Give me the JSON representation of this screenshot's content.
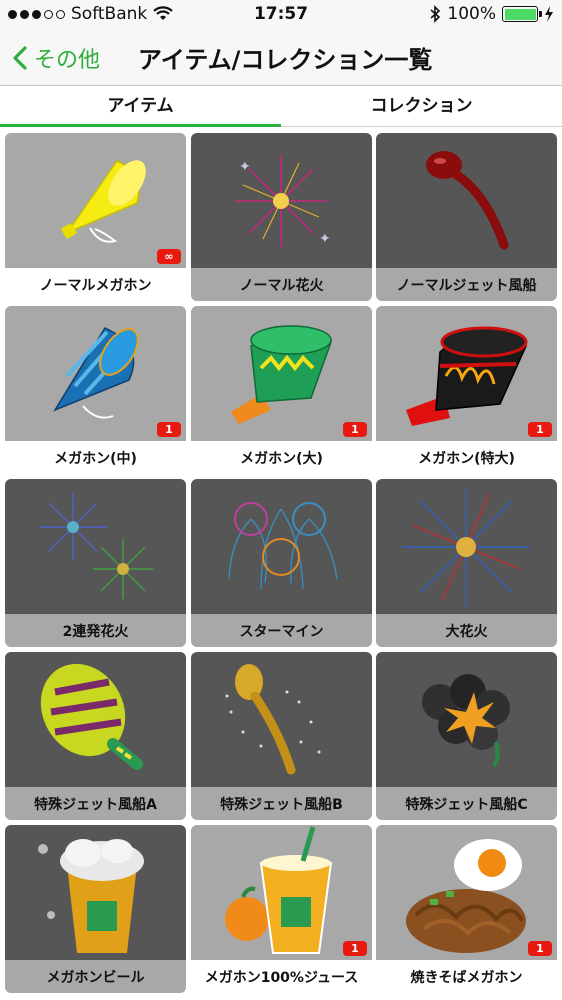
{
  "status_bar": {
    "carrier": "SoftBank",
    "time": "17:57",
    "battery_percent": "100%",
    "signal_bars_filled": 3,
    "signal_bars_total": 5
  },
  "nav": {
    "back_label": "その他",
    "title": "アイテム/コレクション一覧"
  },
  "tabs": [
    {
      "label": "アイテム",
      "active": true
    },
    {
      "label": "コレクション",
      "active": false
    }
  ],
  "colors": {
    "accent": "#2eae3a",
    "badge": "#e8190f"
  },
  "items": [
    {
      "name": "ノーマルメガホン",
      "badge": "∞",
      "owned": true,
      "icon": "megaphone-yellow-icon"
    },
    {
      "name": "ノーマル花火",
      "badge": "",
      "owned": false,
      "icon": "firework-icon"
    },
    {
      "name": "ノーマルジェット風船",
      "badge": "",
      "owned": false,
      "icon": "jet-balloon-red-icon"
    },
    {
      "name": "メガホン(中)",
      "badge": "1",
      "owned": true,
      "icon": "megaphone-blue-icon"
    },
    {
      "name": "メガホン(大)",
      "badge": "1",
      "owned": true,
      "icon": "megaphone-green-icon"
    },
    {
      "name": "メガホン(特大)",
      "badge": "1",
      "owned": true,
      "icon": "megaphone-black-icon"
    },
    {
      "name": "2連発花火",
      "badge": "",
      "owned": false,
      "icon": "double-firework-icon"
    },
    {
      "name": "スターマイン",
      "badge": "",
      "owned": false,
      "icon": "starmine-firework-icon"
    },
    {
      "name": "大花火",
      "badge": "",
      "owned": false,
      "icon": "big-firework-icon"
    },
    {
      "name": "特殊ジェット風船A",
      "badge": "",
      "owned": false,
      "icon": "jet-balloon-striped-icon"
    },
    {
      "name": "特殊ジェット風船B",
      "badge": "",
      "owned": false,
      "icon": "jet-balloon-gold-icon"
    },
    {
      "name": "特殊ジェット風船C",
      "badge": "",
      "owned": false,
      "icon": "jet-balloon-black-icon"
    },
    {
      "name": "メガホンビール",
      "badge": "",
      "owned": false,
      "icon": "beer-cup-icon"
    },
    {
      "name": "メガホン100%ジュース",
      "badge": "1",
      "owned": true,
      "icon": "juice-cup-icon"
    },
    {
      "name": "焼きそばメガホン",
      "badge": "1",
      "owned": true,
      "icon": "yakisoba-icon"
    }
  ]
}
